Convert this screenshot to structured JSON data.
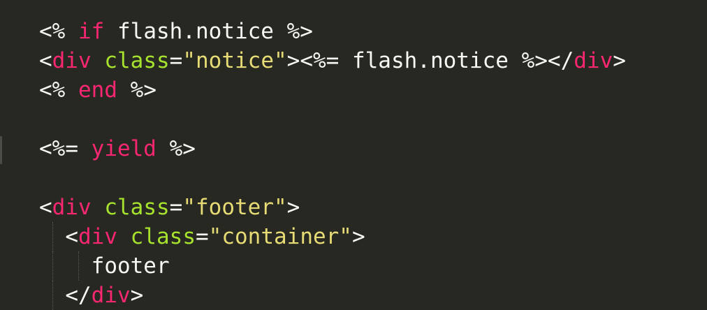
{
  "colors": {
    "background": "#272822",
    "text": "#f8f8f2",
    "keyword": "#f92672",
    "tag": "#f92672",
    "attribute": "#a6e22e",
    "string": "#e6db74"
  },
  "lines": [
    [
      {
        "text": "<% ",
        "kind": "text"
      },
      {
        "text": "if",
        "kind": "kw"
      },
      {
        "text": " flash.notice %>",
        "kind": "text"
      }
    ],
    [
      {
        "text": "<",
        "kind": "text"
      },
      {
        "text": "div",
        "kind": "tag"
      },
      {
        "text": " ",
        "kind": "text"
      },
      {
        "text": "class",
        "kind": "attr"
      },
      {
        "text": "=",
        "kind": "text"
      },
      {
        "text": "\"notice\"",
        "kind": "str"
      },
      {
        "text": "><%= flash.notice %></",
        "kind": "text"
      },
      {
        "text": "div",
        "kind": "tag"
      },
      {
        "text": ">",
        "kind": "text"
      }
    ],
    [
      {
        "text": "<% ",
        "kind": "text"
      },
      {
        "text": "end",
        "kind": "kw"
      },
      {
        "text": " %>",
        "kind": "text"
      }
    ],
    [],
    [
      {
        "text": "<%= ",
        "kind": "text"
      },
      {
        "text": "yield",
        "kind": "kw"
      },
      {
        "text": " %>",
        "kind": "text"
      }
    ],
    [],
    [
      {
        "text": "<",
        "kind": "text"
      },
      {
        "text": "div",
        "kind": "tag"
      },
      {
        "text": " ",
        "kind": "text"
      },
      {
        "text": "class",
        "kind": "attr"
      },
      {
        "text": "=",
        "kind": "text"
      },
      {
        "text": "\"footer\"",
        "kind": "str"
      },
      {
        "text": ">",
        "kind": "text"
      }
    ],
    [
      {
        "text": "  <",
        "kind": "text"
      },
      {
        "text": "div",
        "kind": "tag"
      },
      {
        "text": " ",
        "kind": "text"
      },
      {
        "text": "class",
        "kind": "attr"
      },
      {
        "text": "=",
        "kind": "text"
      },
      {
        "text": "\"container\"",
        "kind": "str"
      },
      {
        "text": ">",
        "kind": "text"
      }
    ],
    [
      {
        "text": "    footer",
        "kind": "text"
      }
    ],
    [
      {
        "text": "  </",
        "kind": "text"
      },
      {
        "text": "div",
        "kind": "tag"
      },
      {
        "text": ">",
        "kind": "text"
      }
    ]
  ]
}
